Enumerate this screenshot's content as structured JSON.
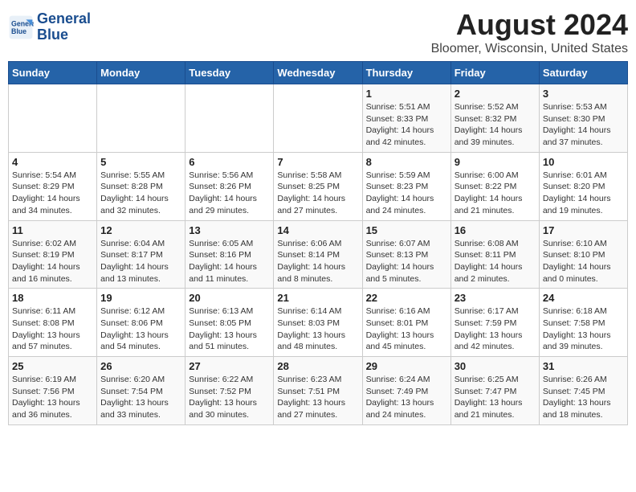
{
  "header": {
    "logo_line1": "General",
    "logo_line2": "Blue",
    "title": "August 2024",
    "subtitle": "Bloomer, Wisconsin, United States"
  },
  "days_of_week": [
    "Sunday",
    "Monday",
    "Tuesday",
    "Wednesday",
    "Thursday",
    "Friday",
    "Saturday"
  ],
  "weeks": [
    [
      {
        "day": "",
        "info": ""
      },
      {
        "day": "",
        "info": ""
      },
      {
        "day": "",
        "info": ""
      },
      {
        "day": "",
        "info": ""
      },
      {
        "day": "1",
        "info": "Sunrise: 5:51 AM\nSunset: 8:33 PM\nDaylight: 14 hours\nand 42 minutes."
      },
      {
        "day": "2",
        "info": "Sunrise: 5:52 AM\nSunset: 8:32 PM\nDaylight: 14 hours\nand 39 minutes."
      },
      {
        "day": "3",
        "info": "Sunrise: 5:53 AM\nSunset: 8:30 PM\nDaylight: 14 hours\nand 37 minutes."
      }
    ],
    [
      {
        "day": "4",
        "info": "Sunrise: 5:54 AM\nSunset: 8:29 PM\nDaylight: 14 hours\nand 34 minutes."
      },
      {
        "day": "5",
        "info": "Sunrise: 5:55 AM\nSunset: 8:28 PM\nDaylight: 14 hours\nand 32 minutes."
      },
      {
        "day": "6",
        "info": "Sunrise: 5:56 AM\nSunset: 8:26 PM\nDaylight: 14 hours\nand 29 minutes."
      },
      {
        "day": "7",
        "info": "Sunrise: 5:58 AM\nSunset: 8:25 PM\nDaylight: 14 hours\nand 27 minutes."
      },
      {
        "day": "8",
        "info": "Sunrise: 5:59 AM\nSunset: 8:23 PM\nDaylight: 14 hours\nand 24 minutes."
      },
      {
        "day": "9",
        "info": "Sunrise: 6:00 AM\nSunset: 8:22 PM\nDaylight: 14 hours\nand 21 minutes."
      },
      {
        "day": "10",
        "info": "Sunrise: 6:01 AM\nSunset: 8:20 PM\nDaylight: 14 hours\nand 19 minutes."
      }
    ],
    [
      {
        "day": "11",
        "info": "Sunrise: 6:02 AM\nSunset: 8:19 PM\nDaylight: 14 hours\nand 16 minutes."
      },
      {
        "day": "12",
        "info": "Sunrise: 6:04 AM\nSunset: 8:17 PM\nDaylight: 14 hours\nand 13 minutes."
      },
      {
        "day": "13",
        "info": "Sunrise: 6:05 AM\nSunset: 8:16 PM\nDaylight: 14 hours\nand 11 minutes."
      },
      {
        "day": "14",
        "info": "Sunrise: 6:06 AM\nSunset: 8:14 PM\nDaylight: 14 hours\nand 8 minutes."
      },
      {
        "day": "15",
        "info": "Sunrise: 6:07 AM\nSunset: 8:13 PM\nDaylight: 14 hours\nand 5 minutes."
      },
      {
        "day": "16",
        "info": "Sunrise: 6:08 AM\nSunset: 8:11 PM\nDaylight: 14 hours\nand 2 minutes."
      },
      {
        "day": "17",
        "info": "Sunrise: 6:10 AM\nSunset: 8:10 PM\nDaylight: 14 hours\nand 0 minutes."
      }
    ],
    [
      {
        "day": "18",
        "info": "Sunrise: 6:11 AM\nSunset: 8:08 PM\nDaylight: 13 hours\nand 57 minutes."
      },
      {
        "day": "19",
        "info": "Sunrise: 6:12 AM\nSunset: 8:06 PM\nDaylight: 13 hours\nand 54 minutes."
      },
      {
        "day": "20",
        "info": "Sunrise: 6:13 AM\nSunset: 8:05 PM\nDaylight: 13 hours\nand 51 minutes."
      },
      {
        "day": "21",
        "info": "Sunrise: 6:14 AM\nSunset: 8:03 PM\nDaylight: 13 hours\nand 48 minutes."
      },
      {
        "day": "22",
        "info": "Sunrise: 6:16 AM\nSunset: 8:01 PM\nDaylight: 13 hours\nand 45 minutes."
      },
      {
        "day": "23",
        "info": "Sunrise: 6:17 AM\nSunset: 7:59 PM\nDaylight: 13 hours\nand 42 minutes."
      },
      {
        "day": "24",
        "info": "Sunrise: 6:18 AM\nSunset: 7:58 PM\nDaylight: 13 hours\nand 39 minutes."
      }
    ],
    [
      {
        "day": "25",
        "info": "Sunrise: 6:19 AM\nSunset: 7:56 PM\nDaylight: 13 hours\nand 36 minutes."
      },
      {
        "day": "26",
        "info": "Sunrise: 6:20 AM\nSunset: 7:54 PM\nDaylight: 13 hours\nand 33 minutes."
      },
      {
        "day": "27",
        "info": "Sunrise: 6:22 AM\nSunset: 7:52 PM\nDaylight: 13 hours\nand 30 minutes."
      },
      {
        "day": "28",
        "info": "Sunrise: 6:23 AM\nSunset: 7:51 PM\nDaylight: 13 hours\nand 27 minutes."
      },
      {
        "day": "29",
        "info": "Sunrise: 6:24 AM\nSunset: 7:49 PM\nDaylight: 13 hours\nand 24 minutes."
      },
      {
        "day": "30",
        "info": "Sunrise: 6:25 AM\nSunset: 7:47 PM\nDaylight: 13 hours\nand 21 minutes."
      },
      {
        "day": "31",
        "info": "Sunrise: 6:26 AM\nSunset: 7:45 PM\nDaylight: 13 hours\nand 18 minutes."
      }
    ]
  ]
}
